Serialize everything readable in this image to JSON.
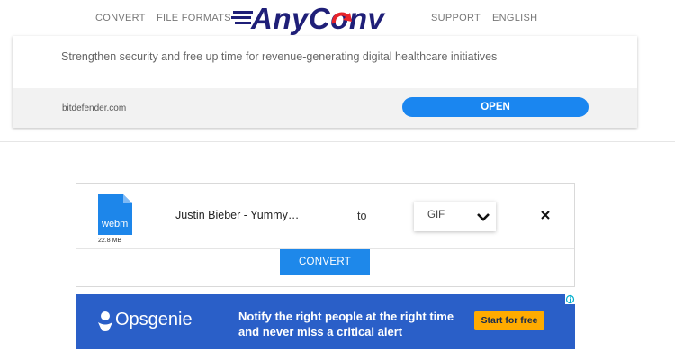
{
  "nav": {
    "convert": "CONVERT",
    "file_formats": "FILE FORMATS",
    "logo_left": "Any",
    "logo_right": "Conv",
    "support": "SUPPORT",
    "language": "ENGLISH"
  },
  "ad_top": {
    "headline": "Strengthen security and free up time for revenue-generating digital healthcare initiatives",
    "domain": "bitdefender.com",
    "button": "OPEN"
  },
  "converter": {
    "file_ext": "webm",
    "file_size": "22.8 MB",
    "file_name": "Justin Bieber - Yummy…",
    "to_label": "to",
    "format": "GIF",
    "convert_button": "CONVERT"
  },
  "ad_bottom": {
    "brand": "Opsgenie",
    "text": "Notify the right people at the right time and never miss a critical alert",
    "cta": "Start for free"
  },
  "colors": {
    "primary_blue": "#1a86f0",
    "ad_blue": "#2a5fc8",
    "cta_yellow": "#ffab00",
    "logo_navy": "#1f1f78",
    "logo_red": "#e8252b"
  },
  "icons": [
    "file-webm-icon",
    "chevron-down-icon",
    "close-icon",
    "opsgenie-logo-icon",
    "adchoices-icon"
  ]
}
